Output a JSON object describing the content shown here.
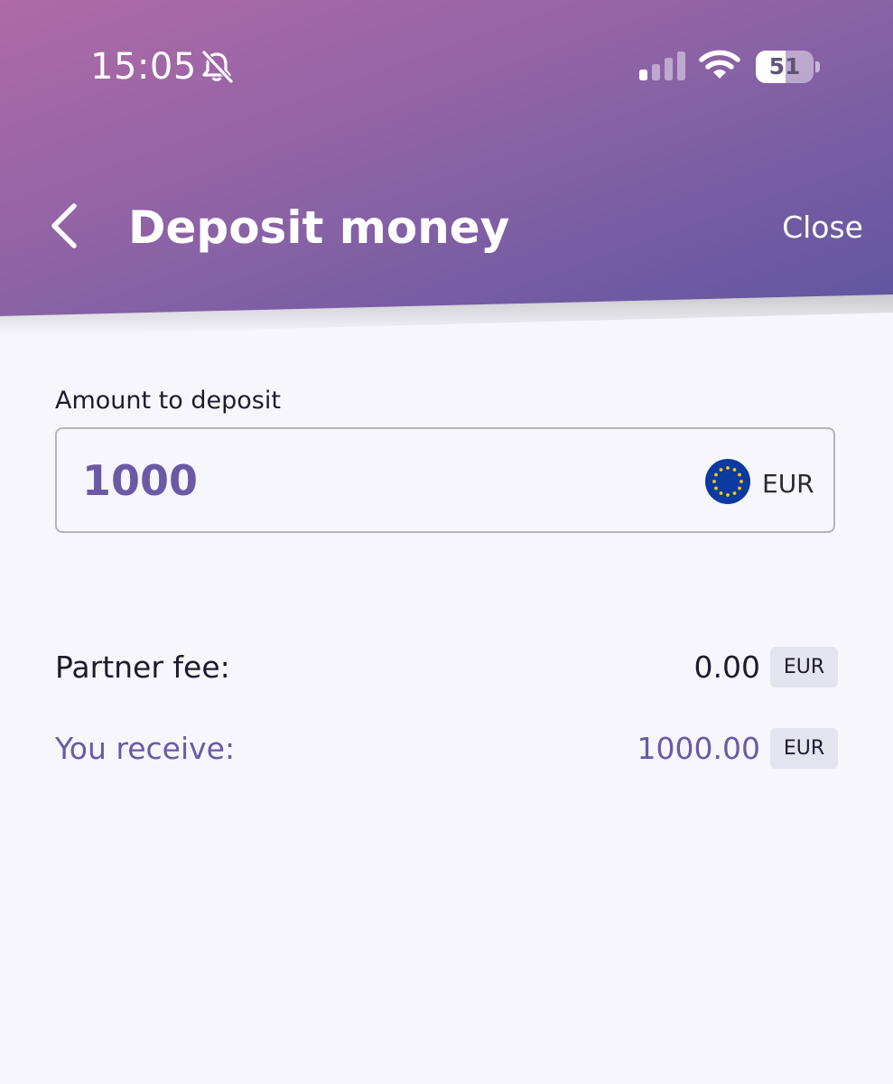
{
  "status_bar": {
    "time": "15:05",
    "icons": [
      "bell-muted-icon",
      "cellular-signal-icon",
      "wifi-icon",
      "battery-icon"
    ],
    "battery_level": "51",
    "battery_fraction": 0.51
  },
  "header": {
    "title": "Deposit money",
    "back_icon": "chevron-left-icon",
    "close_label": "Close",
    "gradient_colors": [
      "#b06aa6",
      "#8a62a6",
      "#5e56a0"
    ]
  },
  "amount": {
    "label": "Amount to deposit",
    "value": "1000",
    "currency_icon": "eu-flag-icon",
    "currency": "EUR"
  },
  "summary": {
    "partner_fee": {
      "label": "Partner fee:",
      "value": "0.00",
      "currency": "EUR"
    },
    "you_receive": {
      "label": "You receive:",
      "value": "1000.00",
      "currency": "EUR"
    }
  },
  "colors": {
    "accent": "#6a5aa6",
    "text": "#1f1a2e",
    "background": "#f6f6fc",
    "chip": "#e4e4ee"
  }
}
